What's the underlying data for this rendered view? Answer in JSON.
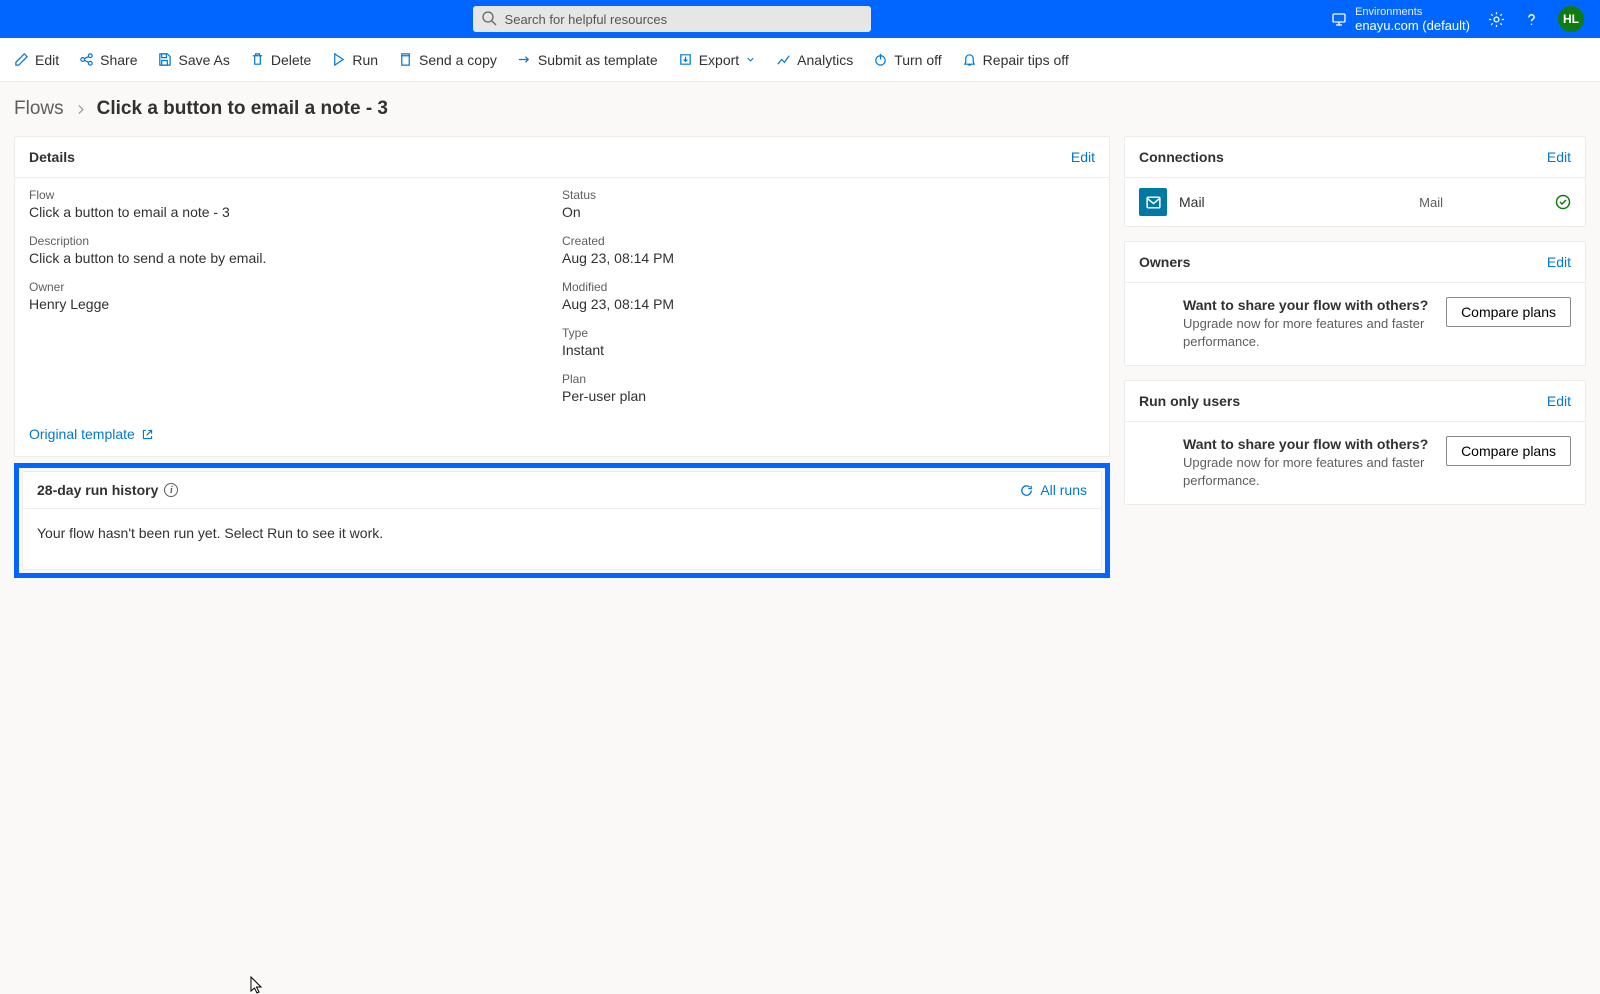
{
  "header": {
    "search_placeholder": "Search for helpful resources",
    "env_label": "Environments",
    "env_name": "enayu.com (default)",
    "avatar_initials": "HL"
  },
  "toolbar": {
    "edit": "Edit",
    "share": "Share",
    "save_as": "Save As",
    "delete": "Delete",
    "run": "Run",
    "send_copy": "Send a copy",
    "submit_template": "Submit as template",
    "export": "Export",
    "analytics": "Analytics",
    "turn_off": "Turn off",
    "repair_tips_off": "Repair tips off"
  },
  "breadcrumb": {
    "root": "Flows",
    "current": "Click a button to email a note - 3"
  },
  "details": {
    "title": "Details",
    "edit": "Edit",
    "labels": {
      "flow": "Flow",
      "description": "Description",
      "owner": "Owner",
      "status": "Status",
      "created": "Created",
      "modified": "Modified",
      "type": "Type",
      "plan": "Plan"
    },
    "values": {
      "flow": "Click a button to email a note - 3",
      "description": "Click a button to send a note by email.",
      "owner": "Henry Legge",
      "status": "On",
      "created": "Aug 23, 08:14 PM",
      "modified": "Aug 23, 08:14 PM",
      "type": "Instant",
      "plan": "Per-user plan"
    },
    "original_template": "Original template"
  },
  "run_history": {
    "title": "28-day run history",
    "all_runs": "All runs",
    "empty": "Your flow hasn't been run yet. Select Run to see it work."
  },
  "connections": {
    "title": "Connections",
    "edit": "Edit",
    "items": [
      {
        "name": "Mail",
        "type": "Mail"
      }
    ]
  },
  "owners": {
    "title": "Owners",
    "edit": "Edit",
    "promo_title": "Want to share your flow with others?",
    "promo_sub": "Upgrade now for more features and faster performance.",
    "compare": "Compare plans"
  },
  "run_only": {
    "title": "Run only users",
    "edit": "Edit",
    "promo_title": "Want to share your flow with others?",
    "promo_sub": "Upgrade now for more features and faster performance.",
    "compare": "Compare plans"
  }
}
